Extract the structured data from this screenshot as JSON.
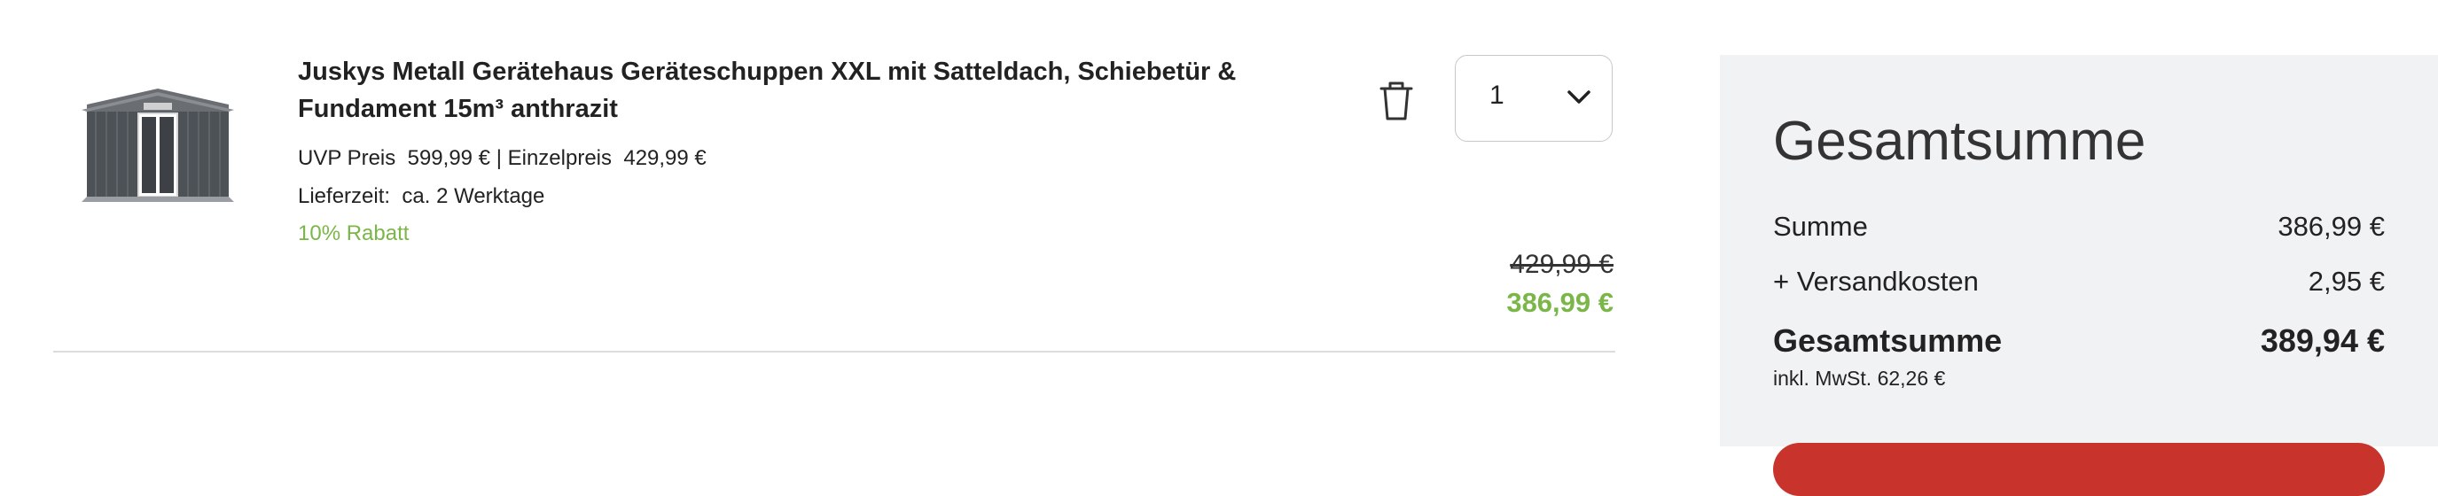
{
  "item": {
    "title": "Juskys Metall Gerätehaus Geräteschuppen XXL mit Satteldach, Schiebetür & Fundament 15m³ anthrazit",
    "uvp_label": "UVP Preis",
    "uvp_value": "599,99 €",
    "separator": " | ",
    "unit_label": "Einzelpreis",
    "unit_value": "429,99 €",
    "delivery_label": "Lieferzeit:",
    "delivery_value": "ca. 2 Werktage",
    "discount": "10% Rabatt",
    "quantity": "1",
    "old_price": "429,99 €",
    "new_price": "386,99 €",
    "image_icon": "garden-shed-image"
  },
  "summary": {
    "title": "Gesamtsumme",
    "rows": [
      {
        "label": "Summe",
        "value": "386,99 €"
      },
      {
        "label": "+ Versandkosten",
        "value": "2,95 €"
      },
      {
        "label": "Gesamtsumme",
        "value": "389,94 €"
      }
    ],
    "tax_note": "inkl. MwSt. 62,26 €"
  },
  "colors": {
    "accent_green": "#7ab648",
    "checkout_red": "#c8342c",
    "summary_bg": "#f1f2f4"
  }
}
